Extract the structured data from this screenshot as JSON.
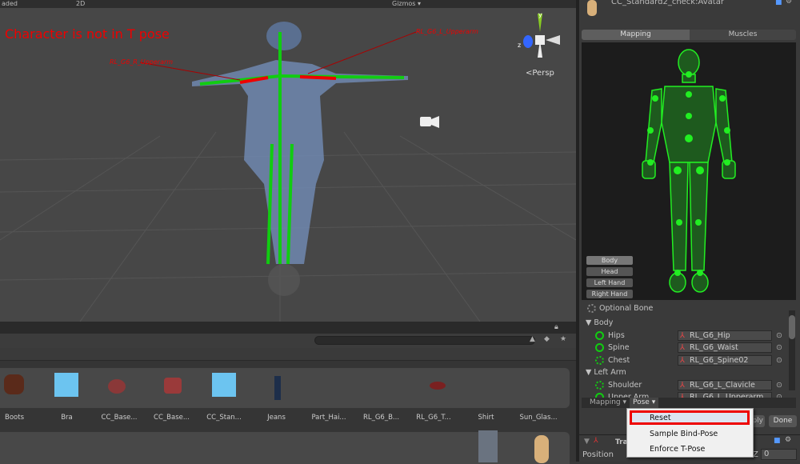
{
  "scene": {
    "toolbar": {
      "shading": "aded",
      "mode_2d": "2D",
      "gizmos": "Gizmos ▾"
    },
    "warning": "Character is not in T pose",
    "bone_labels": [
      "RL_G6_R_Upperarm",
      "RL_G6_L_Upperarm"
    ],
    "persp": "<Persp",
    "axes": [
      "y",
      "z",
      "x"
    ]
  },
  "inspector": {
    "title": "CC_Standard2_check:Avatar",
    "tabs": [
      {
        "label": "Mapping",
        "active": true
      },
      {
        "label": "Muscles",
        "active": false
      }
    ],
    "body_parts": [
      "Body",
      "Head",
      "Left Hand",
      "Right Hand"
    ],
    "optional_bone": "Optional Bone",
    "groups": [
      {
        "label": "Body",
        "bones": [
          {
            "name": "Hips",
            "value": "RL_G6_Hip",
            "required": true
          },
          {
            "name": "Spine",
            "value": "RL_G6_Waist",
            "required": true
          },
          {
            "name": "Chest",
            "value": "RL_G6_Spine02",
            "required": false
          }
        ]
      },
      {
        "label": "Left Arm",
        "bones": [
          {
            "name": "Shoulder",
            "value": "RL_G6_L_Clavicle",
            "required": false
          },
          {
            "name": "Upper Arm",
            "value": "RL_G6_L_Upperarm",
            "required": true
          }
        ]
      }
    ],
    "bottom_menus": [
      "Mapping ▾",
      "Pose ▾"
    ],
    "buttons": {
      "apply": "Apply",
      "done": "Done"
    },
    "transform": {
      "title": "Transform",
      "position_label": "Position",
      "z_label": "Z",
      "z_value": "0"
    },
    "accent": "#22cc22"
  },
  "pose_menu": {
    "items": [
      "Reset",
      "Sample Bind-Pose",
      "Enforce T-Pose"
    ],
    "highlighted": "Reset",
    "highlight_color": "#e00000"
  },
  "project": {
    "search_placeholder": "",
    "row1": [
      "Boots",
      "Bra",
      "CC_Base...",
      "CC_Base...",
      "CC_Stan...",
      "Jeans",
      "Part_Hai...",
      "RL_G6_B...",
      "RL_G6_T...",
      "Shirt",
      "Sun_Glas..."
    ]
  }
}
